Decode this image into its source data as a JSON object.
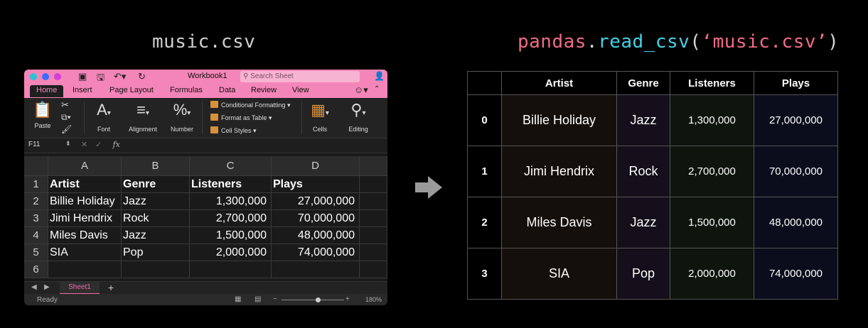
{
  "titles": {
    "left": "music.csv",
    "right_prefix": "pandas",
    "right_dot": ".",
    "right_func": "read_csv",
    "right_open": "(",
    "right_arg": "‘music.csv’",
    "right_close": ")"
  },
  "excel": {
    "workbook_title": "Workbook1",
    "search_placeholder": "Search Sheet",
    "tabs": [
      "Home",
      "Insert",
      "Page Layout",
      "Formulas",
      "Data",
      "Review",
      "View"
    ],
    "ribbon": {
      "paste": "Paste",
      "font": "Font",
      "alignment": "Alignment",
      "number": "Number",
      "conditional_formatting": "Conditional Formatting",
      "format_as_table": "Format as Table",
      "cell_styles": "Cell Styles",
      "cells": "Cells",
      "editing": "Editing"
    },
    "name_box": "F11",
    "fx_label": "fx",
    "columns": [
      "A",
      "B",
      "C",
      "D"
    ],
    "row_numbers": [
      "1",
      "2",
      "3",
      "4",
      "5",
      "6"
    ],
    "header_row": [
      "Artist",
      "Genre",
      "Listeners",
      "Plays"
    ],
    "rows": [
      [
        "Billie Holiday",
        "Jazz",
        "1,300,000",
        "27,000,000"
      ],
      [
        "Jimi Hendrix",
        "Rock",
        "2,700,000",
        "70,000,000"
      ],
      [
        "Miles Davis",
        "Jazz",
        "1,500,000",
        "48,000,000"
      ],
      [
        "SIA",
        "Pop",
        "2,000,000",
        "74,000,000"
      ]
    ],
    "sheet_tab": "Sheet1",
    "status": "Ready",
    "zoom": "180%"
  },
  "dataframe": {
    "columns": [
      "Artist",
      "Genre",
      "Listeners",
      "Plays"
    ],
    "index": [
      "0",
      "1",
      "2",
      "3"
    ],
    "rows": [
      [
        "Billie Holiday",
        "Jazz",
        "1,300,000",
        "27,000,000"
      ],
      [
        "Jimi Hendrix",
        "Rock",
        "2,700,000",
        "70,000,000"
      ],
      [
        "Miles Davis",
        "Jazz",
        "1,500,000",
        "48,000,000"
      ],
      [
        "SIA",
        "Pop",
        "2,000,000",
        "74,000,000"
      ]
    ]
  },
  "colors": {
    "excel_accent": "#f485b8",
    "title_pink": "#f06b86",
    "title_cyan": "#45d0e5"
  }
}
